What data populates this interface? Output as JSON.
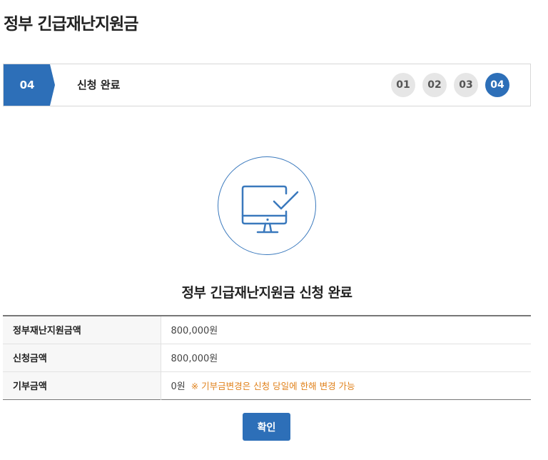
{
  "page": {
    "title": "정부 긴급재난지원금"
  },
  "step": {
    "current_number": "04",
    "current_name": "신청 완료",
    "steps": [
      "01",
      "02",
      "03",
      "04"
    ],
    "active_index": 3
  },
  "complete": {
    "icon": "monitor-check-icon",
    "title": "정부 긴급재난지원금 신청 완료"
  },
  "table": {
    "rows": [
      {
        "label": "정부재난지원금액",
        "value": "800,000원"
      },
      {
        "label": "신청금액",
        "value": "800,000원"
      },
      {
        "label": "기부금액",
        "value": "0원",
        "note": "※ 기부금변경은 신청 당일에 한해 변경 가능"
      }
    ]
  },
  "actions": {
    "confirm_label": "확인"
  },
  "colors": {
    "accent": "#2d6fb8",
    "note": "#e0821c",
    "inactive_step": "#e6e6e6"
  }
}
